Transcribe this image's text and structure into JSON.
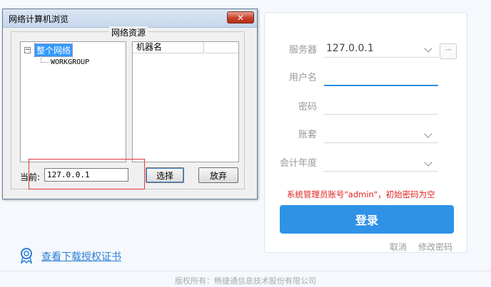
{
  "dialog": {
    "title": "网络计算机浏览",
    "close_glyph": "✕",
    "group_label": "网络资源",
    "tree": {
      "expander": "−",
      "root": "整个网络",
      "child": "WORKGROUP"
    },
    "list_header": "机器名",
    "current_label": "当前:",
    "current_value": "127.0.0.1",
    "select_label": "选择",
    "abandon_label": "放弃"
  },
  "login": {
    "server_label": "服务器",
    "server_value": "127.0.0.1",
    "more_glyph": "···",
    "username_label": "用户名",
    "password_label": "密码",
    "account_label": "账套",
    "year_label": "会计年度",
    "hint": "系统管理员账号\"admin\"，初始密码为空",
    "login_label": "登录",
    "cancel_label": "取消",
    "change_password_label": "修改密码"
  },
  "footer": {
    "cert_link": "查看下载授权证书",
    "copyright": "版权所有：畅捷通信息技术股份有限公司"
  },
  "colors": {
    "accent": "#2f92e6",
    "hint_red": "#e02020",
    "highlight_red": "#e0393e"
  }
}
